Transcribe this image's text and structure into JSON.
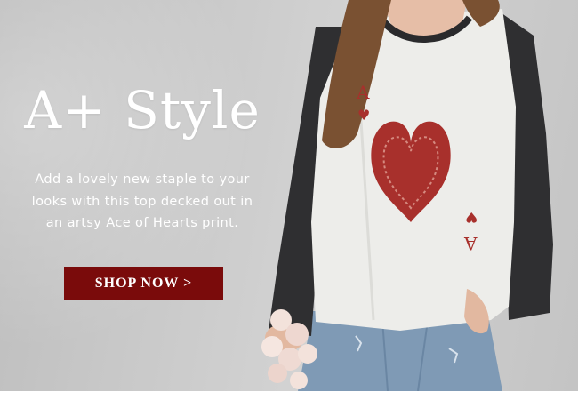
{
  "hero": {
    "headline": "A+ Style",
    "blurb": "Add a lovely new staple to your looks with this top decked out in an artsy Ace of Hearts print.",
    "cta_label": "SHOP NOW >"
  },
  "photo": {
    "card_rank": "A",
    "card_suit": "♥"
  },
  "colors": {
    "accent": "#7a0b0b",
    "heart": "#a8302c",
    "background": "#c8c8c8"
  }
}
